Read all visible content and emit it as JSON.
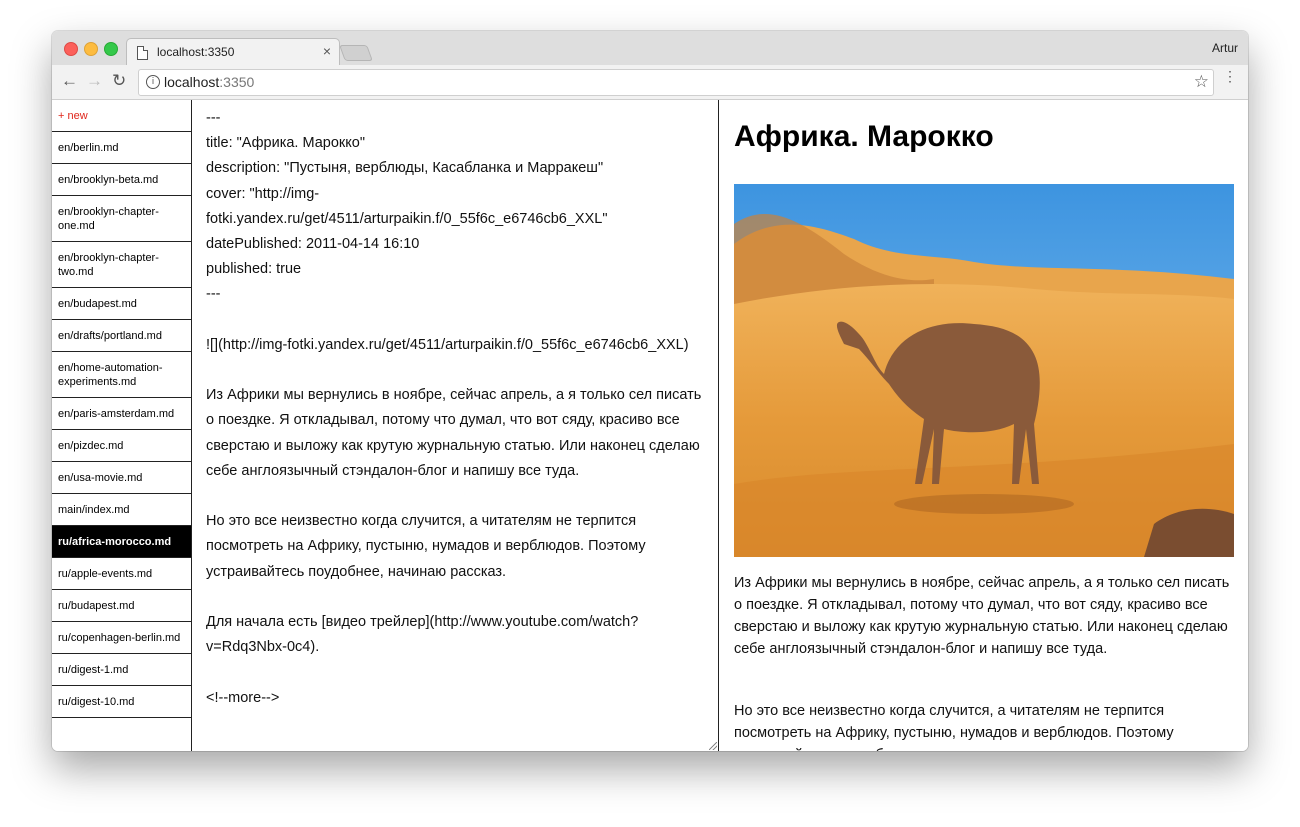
{
  "browser": {
    "tab_title": "localhost:3350",
    "tab_close": "×",
    "profile": "Artur",
    "url_host": "localhost",
    "url_port": ":3350",
    "back_glyph": "←",
    "forward_glyph": "→",
    "reload_glyph": "↻",
    "info_glyph": "i",
    "star_glyph": "☆",
    "menu_glyph": "⋮"
  },
  "sidebar": {
    "new_label": "+ new",
    "items": [
      {
        "label": "en/berlin.md"
      },
      {
        "label": "en/brooklyn-beta.md"
      },
      {
        "label": "en/brooklyn-chapter-one.md"
      },
      {
        "label": "en/brooklyn-chapter-two.md"
      },
      {
        "label": "en/budapest.md"
      },
      {
        "label": "en/drafts/portland.md"
      },
      {
        "label": "en/home-automation-experiments.md"
      },
      {
        "label": "en/paris-amsterdam.md"
      },
      {
        "label": "en/pizdec.md"
      },
      {
        "label": "en/usa-movie.md"
      },
      {
        "label": "main/index.md"
      },
      {
        "label": "ru/africa-morocco.md",
        "active": true
      },
      {
        "label": "ru/apple-events.md"
      },
      {
        "label": "ru/budapest.md"
      },
      {
        "label": "ru/copenhagen-berlin.md"
      },
      {
        "label": "ru/digest-1.md"
      },
      {
        "label": "ru/digest-10.md"
      }
    ]
  },
  "editor": {
    "text": "---\ntitle: \"Африка. Марокко\"\ndescription: \"Пустыня, верблюды, Касабланка и Марракеш\"\ncover: \"http://img-fotki.yandex.ru/get/4511/arturpaikin.f/0_55f6c_e6746cb6_XXL\"\ndatePublished: 2011-04-14 16:10\npublished: true\n---\n\n![](http://img-fotki.yandex.ru/get/4511/arturpaikin.f/0_55f6c_e6746cb6_XXL)\n\nИз Африки мы вернулись в ноябре, сейчас апрель, а я только сел писать о поездке. Я откладывал, потому что думал, что вот сяду, красиво все сверстаю и выложу как крутую журнальную статью. Или наконец сделаю себе англоязычный стэндалон-блог и напишу все туда.\n\nНо это все неизвестно когда случится, а читателям не терпится посмотреть на Африку, пустыню, нумадов и верблюдов. Поэтому устраивайтесь поудобнее, начинаю рассказ.\n\nДля начала есть [видео трейлер](http://www.youtube.com/watch?v=Rdq3Nbx-0c4).\n\n<!--more-->"
  },
  "preview": {
    "title": "Африка. Марокко",
    "paragraph_1": "Из Африки мы вернулись в ноябре, сейчас апрель, а я только сел писать о поездке. Я откладывал, потому что думал, что вот сяду, красиво все сверстаю и выложу как крутую журнальную статью. Или наконец сделаю себе англоязычный стэндалон-блог и напишу все туда.",
    "paragraph_2": "Но это все неизвестно когда случится, а читателям не терпится посмотреть на Африку, пустыню, нумадов и верблюдов. Поэтому устраивайтесь поудобнее, начинаю рассказ."
  },
  "colors": {
    "new_link": "#e0261b",
    "active_item_bg": "#000000",
    "sky": "#4aa3e6",
    "sand": "#e59a3a"
  }
}
